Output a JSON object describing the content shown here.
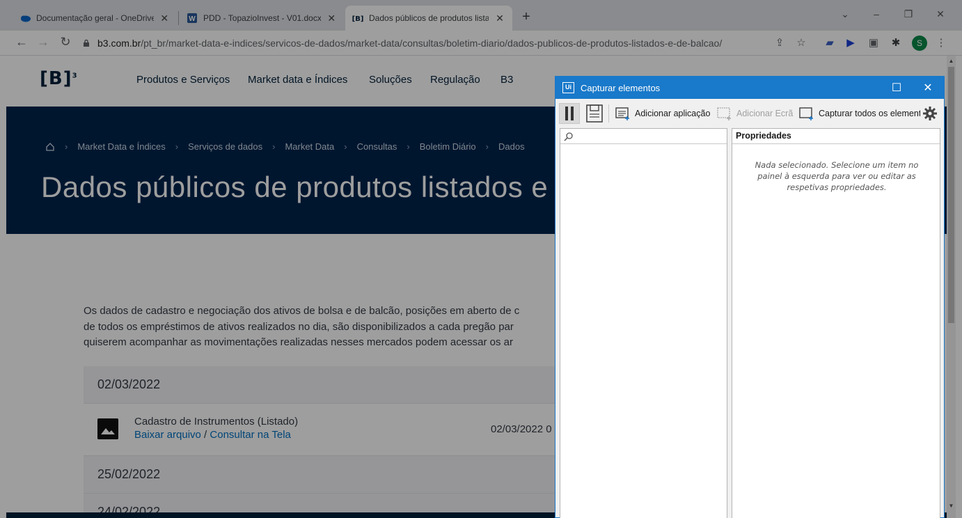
{
  "browser": {
    "tabs": [
      {
        "title": "Documentação geral - OneDrive",
        "close": "✕"
      },
      {
        "title": "PDD - TopazioInvest - V01.docx",
        "close": "✕"
      },
      {
        "title": "Dados públicos de produtos lista",
        "close": "✕"
      }
    ],
    "new_tab": "+",
    "url_host": "b3.com.br",
    "url_path": "/pt_br/market-data-e-indices/servicos-de-dados/market-data/consultas/boletim-diario/dados-publicos-de-produtos-listados-e-de-balcao/",
    "profile_initial": "S"
  },
  "site": {
    "logo": "[B]",
    "logo_sup": "3",
    "nav": [
      "Produtos e Serviços",
      "Market data e Índices",
      "Soluções",
      "Regulação",
      "B3"
    ],
    "breadcrumbs": [
      "Market Data e Índices",
      "Serviços de dados",
      "Market Data",
      "Consultas",
      "Boletim Diário",
      "Dados"
    ],
    "hero_title": "Dados públicos de produtos listados e",
    "intro_lines": [
      "Os dados de cadastro e negociação dos ativos de bolsa e de balcão, posições em aberto de c",
      "de todos os empréstimos de ativos realizados no dia, são disponibilizados a cada pregão par",
      "quiserem acompanhar as movimentações realizadas nesses mercados podem acessar os ar"
    ],
    "dates": [
      "02/03/2022",
      "25/02/2022",
      "24/02/2022"
    ],
    "file": {
      "name": "Cadastro de Instrumentos (Listado)",
      "download": "Baixar arquivo",
      "separator": " / ",
      "view": "Consultar na Tela",
      "date": "02/03/2022 0"
    }
  },
  "dialog": {
    "title": "Capturar elementos",
    "add_app": "Adicionar aplicação",
    "add_screen": "Adicionar Ecrã",
    "capture_all": "Capturar todos os elemento",
    "properties_header": "Propriedades",
    "empty_message": "Nada selecionado. Selecione um item no painel à esquerda para ver ou editar as respetivas propriedades."
  }
}
